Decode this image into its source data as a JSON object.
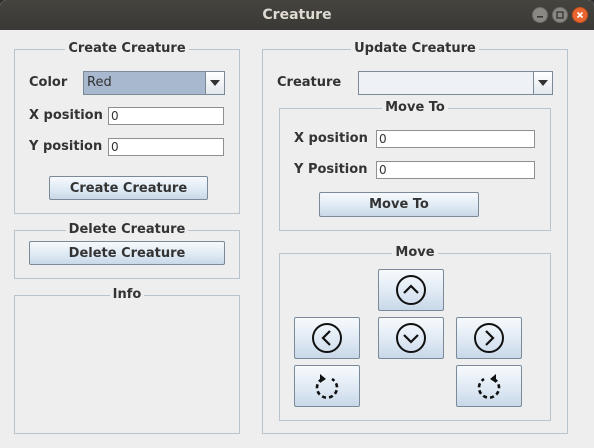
{
  "window": {
    "title": "Creature"
  },
  "create_group": {
    "title": "Create Creature",
    "color_label": "Color",
    "color_value": "Red",
    "x_label": "X position",
    "x_value": "0",
    "y_label": "Y position",
    "y_value": "0",
    "button_label": "Create Creature"
  },
  "delete_group": {
    "title": "Delete Creature",
    "button_label": "Delete Creature"
  },
  "info_group": {
    "title": "Info"
  },
  "update_group": {
    "title": "Update Creature",
    "creature_label": "Creature",
    "creature_value": "",
    "moveto": {
      "title": "Move To",
      "x_label": "X position",
      "x_value": "0",
      "y_label": "Y Position",
      "y_value": "0",
      "button_label": "Move To"
    },
    "move": {
      "title": "Move"
    }
  },
  "icons": [
    "minimize-icon",
    "maximize-icon",
    "close-icon",
    "arrow-up-icon",
    "arrow-left-icon",
    "arrow-down-icon",
    "arrow-right-icon",
    "rotate-left-icon",
    "rotate-right-icon",
    "chevron-down-icon"
  ],
  "colors": {
    "titlebar": "#3c3b37",
    "close": "#e9652f",
    "selected_combo": "#a7b8cf",
    "border": "#b7c3cf"
  }
}
